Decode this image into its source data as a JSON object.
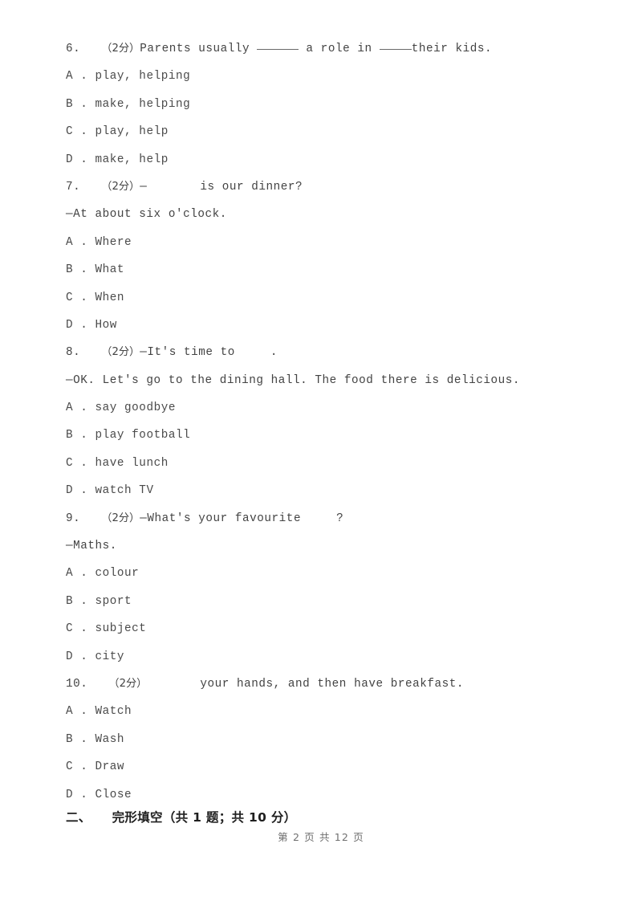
{
  "document": {
    "type": "exam-worksheet",
    "language": "zh-CN / en",
    "page_number_footer": "第 2 页 共 12 页"
  },
  "questions": [
    {
      "number": "6.",
      "marks": "（2分）",
      "stem_before": "Parents usually ",
      "stem_mid": " a role in ",
      "stem_after": "their kids.",
      "options": [
        {
          "letter": "A",
          "sep": " . ",
          "text": "play, helping"
        },
        {
          "letter": "B",
          "sep": " . ",
          "text": "make, helping"
        },
        {
          "letter": "C",
          "sep": " . ",
          "text": "play, help"
        },
        {
          "letter": "D",
          "sep": " . ",
          "text": "make, help"
        }
      ]
    },
    {
      "number": "7.",
      "marks": "（2分）",
      "stem_before": "—",
      "stem_after": "is our dinner?",
      "answer_line": "—At about six o'clock.",
      "options": [
        {
          "letter": "A",
          "sep": " . ",
          "text": "Where"
        },
        {
          "letter": "B",
          "sep": " . ",
          "text": "What"
        },
        {
          "letter": "C",
          "sep": " . ",
          "text": "When"
        },
        {
          "letter": "D",
          "sep": " . ",
          "text": "How"
        }
      ]
    },
    {
      "number": "8.",
      "marks": "（2分）",
      "stem_before": "—It's time to",
      "stem_after": ".",
      "answer_line": "—OK. Let's go to the dining hall. The food there is delicious.",
      "options": [
        {
          "letter": "A",
          "sep": " . ",
          "text": "say goodbye"
        },
        {
          "letter": "B",
          "sep": " . ",
          "text": "play football"
        },
        {
          "letter": "C",
          "sep": " . ",
          "text": "have lunch"
        },
        {
          "letter": "D",
          "sep": " . ",
          "text": "watch TV"
        }
      ]
    },
    {
      "number": "9.",
      "marks": "（2分）",
      "stem_before": "—What's your favourite",
      "stem_after": "?",
      "answer_line": "—Maths.",
      "options": [
        {
          "letter": "A",
          "sep": " . ",
          "text": "colour"
        },
        {
          "letter": "B",
          "sep": " . ",
          "text": "sport"
        },
        {
          "letter": "C",
          "sep": " . ",
          "text": "subject"
        },
        {
          "letter": "D",
          "sep": " . ",
          "text": "city"
        }
      ]
    },
    {
      "number": "10.",
      "marks": "（2分）",
      "stem_after": "your hands, and then have breakfast.",
      "options": [
        {
          "letter": "A",
          "sep": " . ",
          "text": "Watch"
        },
        {
          "letter": "B",
          "sep": " . ",
          "text": "Wash"
        },
        {
          "letter": "C",
          "sep": " . ",
          "text": "Draw"
        },
        {
          "letter": "D",
          "sep": " . ",
          "text": "Close"
        }
      ]
    }
  ],
  "section": {
    "index": "二、",
    "title": "完形填空",
    "meta": "（共 1 题；共 10 分）"
  },
  "footer": {
    "text": "第 2 页 共 12 页"
  }
}
